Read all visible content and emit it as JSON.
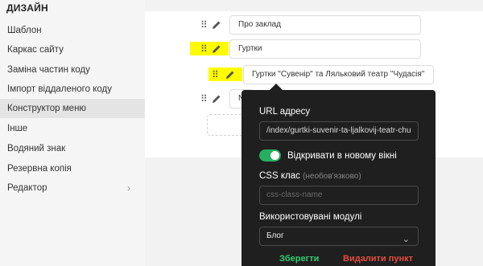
{
  "sidebar": {
    "header": "ДИЗАЙН",
    "items": [
      {
        "label": "Шаблон"
      },
      {
        "label": "Каркас сайту"
      },
      {
        "label": "Заміна частин коду"
      },
      {
        "label": "Імпорт віддаленого коду"
      },
      {
        "label": "Конструктор меню",
        "active": true
      },
      {
        "label": "Інше"
      },
      {
        "label": "Водяний знак"
      },
      {
        "label": "Резервна копія"
      },
      {
        "label": "Редактор",
        "has_submenu": true
      }
    ]
  },
  "menu_tree": {
    "items": [
      {
        "label": "Про заклад"
      },
      {
        "label": "Гуртки"
      },
      {
        "label": "Гуртки \"Сувенір\" та Ляльковий театр \"Чудасія\""
      },
      {
        "label": "N"
      }
    ]
  },
  "popover": {
    "url_label": "URL адресу",
    "url_value": "/index/gurtki-suvenir-ta-ljalkovij-teatr-chu",
    "new_window_label": "Відкривати в новому вікні",
    "new_window_enabled": true,
    "css_label": "CSS клас",
    "css_hint": "(необов'язково)",
    "css_placeholder": "css-class-name",
    "modules_label": "Використовувані модулі",
    "modules_value": "Блог",
    "save_label": "Зберегти",
    "delete_label": "Видалити пункт"
  },
  "colors": {
    "highlight": "#fffb00",
    "toggle_on": "#27ae60",
    "save": "#2ecc71",
    "delete": "#e74c3c"
  }
}
